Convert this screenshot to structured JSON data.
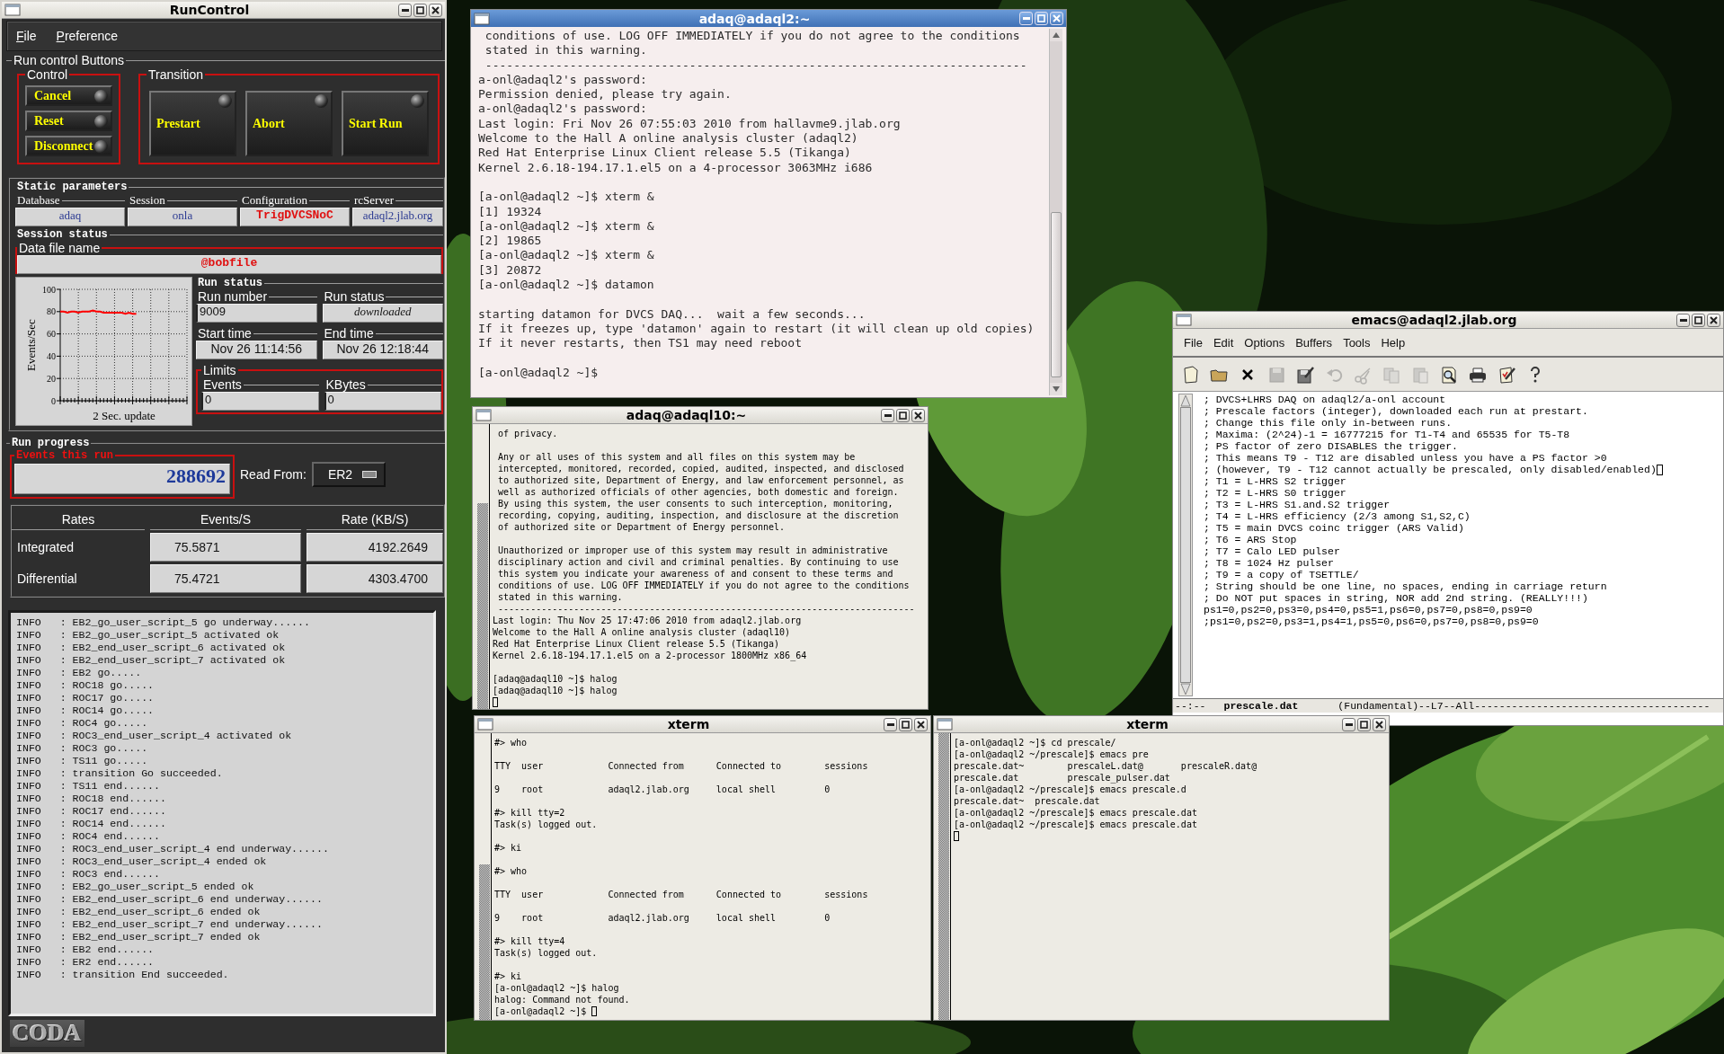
{
  "windows": [
    {
      "kind": "runcontrol",
      "title": "RunControl",
      "menu": [
        "File",
        "Preference"
      ],
      "button_panel": {
        "title": "Run control Buttons",
        "groups": [
          {
            "title": "Control",
            "kind": "stack",
            "buttons": [
              "Cancel",
              "Reset",
              "Disconnect"
            ]
          },
          {
            "title": "Transition",
            "kind": "row",
            "buttons": [
              "Prestart",
              "Abort",
              "Start Run"
            ]
          }
        ]
      },
      "static_parameters": {
        "title": "Static parameters",
        "fields": [
          {
            "label": "Database",
            "value": "adaq",
            "color": "#2b3a92",
            "highlighted": false
          },
          {
            "label": "Session",
            "value": "onla",
            "color": "#2b3a92",
            "highlighted": false
          },
          {
            "label": "Configuration",
            "value": "TrigDVCSNoC",
            "color": "#e01010",
            "highlighted": true
          },
          {
            "label": "rcServer",
            "value": "adaql2.jlab.org",
            "color": "#2b3a92",
            "highlighted": false
          }
        ]
      },
      "session_status": {
        "title": "Session status",
        "data_file": {
          "label": "Data file name",
          "value": "@bobfile"
        },
        "chart_data": {
          "type": "line",
          "xlabel": "2 Sec. update",
          "ylabel": "Events/Sec",
          "categories": [
            null,
            null,
            null,
            null,
            null,
            null,
            null,
            null,
            null,
            null,
            null,
            null,
            null,
            null,
            null,
            null,
            null,
            null,
            null,
            null,
            null,
            null,
            null,
            null,
            null,
            null,
            null,
            null,
            null,
            null,
            null,
            null,
            null,
            null,
            null,
            null
          ],
          "ylim": [
            0,
            100
          ],
          "yticks": [
            0,
            20,
            40,
            60,
            80,
            100
          ],
          "grid": true,
          "series": [
            {
              "color": "#ff0000",
              "values": [
                80,
                80,
                79,
                80,
                80,
                79,
                80,
                80,
                80,
                81,
                80,
                80,
                79,
                79,
                79,
                79,
                79,
                79,
                78,
                79,
                78,
                78,
                null,
                null,
                null,
                null,
                null,
                null,
                null,
                null,
                null,
                null,
                null,
                null,
                null,
                null
              ]
            }
          ]
        },
        "run_status": {
          "title": "Run status",
          "fields": [
            {
              "label": "Run number",
              "value": "9009",
              "kind": "entry"
            },
            {
              "label": "Run status",
              "value": "downloaded",
              "kind": "status"
            },
            {
              "label": "Start time",
              "value": "Nov 26 11:14:56",
              "kind": "time"
            },
            {
              "label": "End time",
              "value": "Nov 26 12:18:44",
              "kind": "time"
            }
          ],
          "limits": {
            "title": "Limits",
            "fields": [
              {
                "label": "Events",
                "value": "0",
                "kind": "entry"
              },
              {
                "label": "KBytes",
                "value": "0",
                "kind": "entry"
              }
            ]
          }
        }
      },
      "run_progress": {
        "title": "Run progress",
        "events": {
          "label": "Events this run",
          "value": "288692"
        },
        "read_from": {
          "label": "Read From:",
          "value": "ER2"
        },
        "rates": {
          "columns": [
            "Rates",
            "Events/S",
            "Rate (KB/S)"
          ],
          "rows": [
            {
              "label": "Integrated",
              "cells": [
                "75.5871",
                "4192.2649"
              ]
            },
            {
              "label": "Differential",
              "cells": [
                "75.4721",
                "4303.4700"
              ]
            }
          ]
        }
      },
      "log": [
        "INFO   : EB2_go_user_script_5 go underway......",
        "INFO   : EB2_go_user_script_5 activated ok",
        "INFO   : EB2_end_user_script_6 activated ok",
        "INFO   : EB2_end_user_script_7 activated ok",
        "INFO   : EB2 go.....",
        "INFO   : ROC18 go.....",
        "INFO   : ROC17 go.....",
        "INFO   : ROC14 go.....",
        "INFO   : ROC4 go.....",
        "INFO   : ROC3_end_user_script_4 activated ok",
        "INFO   : ROC3 go.....",
        "INFO   : TS11 go.....",
        "INFO   : transition Go succeeded.",
        "INFO   : TS11 end......",
        "INFO   : ROC18 end......",
        "INFO   : ROC17 end......",
        "INFO   : ROC14 end......",
        "INFO   : ROC4 end......",
        "INFO   : ROC3_end_user_script_4 end underway......",
        "INFO   : ROC3_end_user_script_4 ended ok",
        "INFO   : ROC3 end......",
        "INFO   : EB2_go_user_script_5 ended ok",
        "INFO   : EB2_end_user_script_6 end underway......",
        "INFO   : EB2_end_user_script_6 ended ok",
        "INFO   : EB2_end_user_script_7 end underway......",
        "INFO   : EB2_end_user_script_7 ended ok",
        "INFO   : EB2 end......",
        "INFO   : ER2 end......",
        "INFO   : transition End succeeded."
      ],
      "logo": "CODA"
    },
    {
      "kind": "gnome-terminal",
      "title": "adaq@adaql2:~",
      "blocks": [
        [
          " conditions of use. LOG OFF IMMEDIATELY if you do not agree to the conditions",
          " stated in this warning.",
          " -----------------------------------------------------------------------------",
          "a-onl@adaql2's password:",
          "Permission denied, please try again.",
          "a-onl@adaql2's password:",
          "Last login: Fri Nov 26 07:55:03 2010 from hallavme9.jlab.org",
          "Welcome to the Hall A online analysis cluster (adaql2)",
          "Red Hat Enterprise Linux Client release 5.5 (Tikanga)",
          "Kernel 2.6.18-194.17.1.el5 on a 4-processor 3063MHz i686"
        ],
        [
          "[a-onl@adaql2 ~]$ xterm &",
          "[1] 19324",
          "[a-onl@adaql2 ~]$ xterm &",
          "[2] 19865",
          "[a-onl@adaql2 ~]$ xterm &",
          "[3] 20872",
          "[a-onl@adaql2 ~]$ datamon"
        ],
        [
          "starting datamon for DVCS DAQ...  wait a few seconds...",
          "If it freezes up, type 'datamon' again to restart (it will clean up old copies)",
          "If it never restarts, then TS1 may need reboot"
        ],
        [
          "[a-onl@adaql2 ~]$"
        ]
      ]
    },
    {
      "kind": "xterm",
      "title": "adaq@adaql10:~",
      "cursor": {
        "kind": "newline"
      },
      "blocks": [
        [
          " of privacy."
        ],
        [
          " Any or all uses of this system and all files on this system may be",
          " intercepted, monitored, recorded, copied, audited, inspected, and disclosed",
          " to authorized site, Department of Energy, and law enforcement personnel, as",
          " well as authorized officials of other agencies, both domestic and foreign.",
          " By using this system, the user consents to such interception, monitoring,",
          " recording, copying, auditing, inspection, and disclosure at the discretion",
          " of authorized site or Department of Energy personnel."
        ],
        [
          " Unauthorized or improper use of this system may result in administrative",
          " disciplinary action and civil and criminal penalties. By continuing to use",
          " this system you indicate your awareness of and consent to these terms and",
          " conditions of use. LOG OFF IMMEDIATELY if you do not agree to the conditions",
          " stated in this warning.",
          " -----------------------------------------------------------------------------",
          "Last login: Thu Nov 25 17:47:06 2010 from adaql2.jlab.org",
          "Welcome to the Hall A online analysis cluster (adaql10)",
          "Red Hat Enterprise Linux Client release 5.5 (Tikanga)",
          "Kernel 2.6.18-194.17.1.el5 on a 2-processor 1800MHz x86_64"
        ],
        [
          "[adaq@adaql10 ~]$ halog",
          "[adaq@adaql10 ~]$ halog"
        ]
      ]
    },
    {
      "kind": "emacs",
      "title": "emacs@adaql2.jlab.org",
      "menu": [
        "File",
        "Edit",
        "Options",
        "Buffers",
        "Tools",
        "Help"
      ],
      "toolbar": [
        {
          "disabled": false
        },
        {
          "disabled": false
        },
        {
          "disabled": false
        },
        {
          "disabled": true
        },
        {
          "disabled": false
        },
        {
          "disabled": true
        },
        {
          "disabled": true
        },
        {
          "disabled": true
        },
        {
          "disabled": true
        },
        {
          "disabled": false
        },
        {
          "disabled": false
        },
        {
          "disabled": false
        },
        {
          "disabled": false
        }
      ],
      "lines": [
        {
          "text": "; DVCS+LHRS DAQ on adaql2/a-onl account",
          "cursor": false
        },
        {
          "text": "; Prescale factors (integer), downloaded each run at prestart.",
          "cursor": false
        },
        {
          "text": "; Change this file only in-between runs.",
          "cursor": false
        },
        {
          "text": "; Maxima: (2^24)-1 = 16777215 for T1-T4 and 65535 for T5-T8",
          "cursor": false
        },
        {
          "text": "; PS factor of zero DISABLES the trigger.",
          "cursor": false
        },
        {
          "text": "; This means T9 - T12 are disabled unless you have a PS factor >0",
          "cursor": false
        },
        {
          "text": "; (however, T9 - T12 cannot actually be prescaled, only disabled/enabled)",
          "cursor": true
        },
        {
          "text": "; T1 = L-HRS S2 trigger",
          "cursor": false
        },
        {
          "text": "; T2 = L-HRS S0 trigger",
          "cursor": false
        },
        {
          "text": "; T3 = L-HRS S1.and.S2 trigger",
          "cursor": false
        },
        {
          "text": "; T4 = L-HRS efficiency (2/3 among S1,S2,C)",
          "cursor": false
        },
        {
          "text": "; T5 = main DVCS coinc trigger (ARS Valid)",
          "cursor": false
        },
        {
          "text": "; T6 = ARS Stop",
          "cursor": false
        },
        {
          "text": "; T7 = Calo LED pulser",
          "cursor": false
        },
        {
          "text": "; T8 = 1024 Hz pulser",
          "cursor": false
        },
        {
          "text": "; T9 = a copy of TSETTLE/",
          "cursor": false
        },
        {
          "text": "; String should be one line, no spaces, ending in carriage return",
          "cursor": false
        },
        {
          "text": "; Do NOT put spaces in string, NOR add 2nd string. (REALLY!!!)",
          "cursor": false
        },
        {
          "text": "ps1=0,ps2=0,ps3=0,ps4=0,ps5=1,ps6=0,ps7=0,ps8=0,ps9=0",
          "cursor": false
        },
        {
          "text": ";ps1=0,ps2=0,ps3=1,ps4=1,ps5=0,ps6=0,ps7=0,ps8=0,ps9=0",
          "cursor": false
        }
      ],
      "modeline": {
        "flags": "--:--",
        "buffer": "prescale.dat",
        "mode": "(Fundamental)--L7--All--------------------------------------"
      }
    },
    {
      "kind": "xterm",
      "title": "xterm",
      "cursor": {
        "kind": "end"
      },
      "blocks": [
        [
          "#> who"
        ],
        [
          "TTY  user            Connected from      Connected to        sessions"
        ],
        [
          "9    root            adaql2.jlab.org     local shell         0"
        ],
        [
          "#> kill tty=2",
          "Task(s) logged out."
        ],
        [
          "#> ki"
        ],
        [
          "#> who"
        ],
        [
          "TTY  user            Connected from      Connected to        sessions"
        ],
        [
          "9    root            adaql2.jlab.org     local shell         0"
        ],
        [
          "#> kill tty=4",
          "Task(s) logged out."
        ],
        [
          "#> ki",
          "[a-onl@adaql2 ~]$ halog",
          "halog: Command not found.",
          "[a-onl@adaql2 ~]$"
        ]
      ]
    },
    {
      "kind": "xterm",
      "title": "xterm",
      "cursor": {
        "kind": "newline"
      },
      "blocks": [
        [
          "[a-onl@adaql2 ~]$ cd prescale/",
          "[a-onl@adaql2 ~/prescale]$ emacs pre",
          "prescale.dat~        prescaleL.dat@       prescaleR.dat@",
          "prescale.dat         prescale_pulser.dat",
          "[a-onl@adaql2 ~/prescale]$ emacs prescale.d",
          "prescale.dat~  prescale.dat",
          "[a-onl@adaql2 ~/prescale]$ emacs prescale.dat",
          "[a-onl@adaql2 ~/prescale]$ emacs prescale.dat"
        ]
      ]
    }
  ]
}
